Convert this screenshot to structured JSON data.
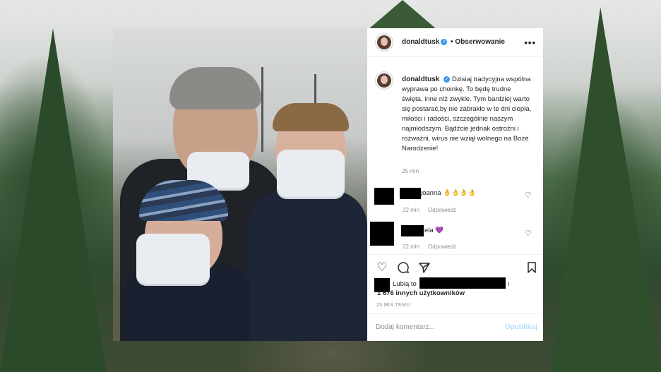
{
  "post": {
    "username": "donaldtusk",
    "follow_separator": "•",
    "follow_label": "Obserwowanie",
    "more_label": "•••",
    "caption": "Dzisiaj tradycyjna wspólna wyprawa po choinkę. To będę trudne święta, inne niż zwykle. Tym bardziej warto się postarać,by nie zabrakło w te dni ciepła, miłości i radości, szczególnie naszym najmłodszym. Bądźcie jednak ostrożni i rozważni, wirus nie wziął wolnego na Boże Narodzenie!",
    "caption_time": "25 min",
    "comments": [
      {
        "text": "joanna 👌👌👌👌",
        "time": "22 min",
        "reply_label": "Odpowiedz"
      },
      {
        "text": "ela 💜",
        "time": "22 min",
        "reply_label": "Odpowiedz"
      }
    ],
    "likes_prefix": "Lubią to",
    "likes_suffix": "i",
    "likes_others": "1 676 innych użytkowników",
    "posted_ago": "25 MIN TEMU",
    "comment_placeholder": "Dodaj komentarz...",
    "publish_label": "Opublikuj"
  },
  "colors": {
    "verified": "#3897f0",
    "publish_disabled": "#b2dffc",
    "meta_gray": "#8e8e8e"
  },
  "icons": {
    "like": "heart-icon",
    "comment": "comment-icon",
    "share": "share-icon",
    "save": "bookmark-icon",
    "more": "more-icon",
    "verified": "verified-badge-icon"
  }
}
